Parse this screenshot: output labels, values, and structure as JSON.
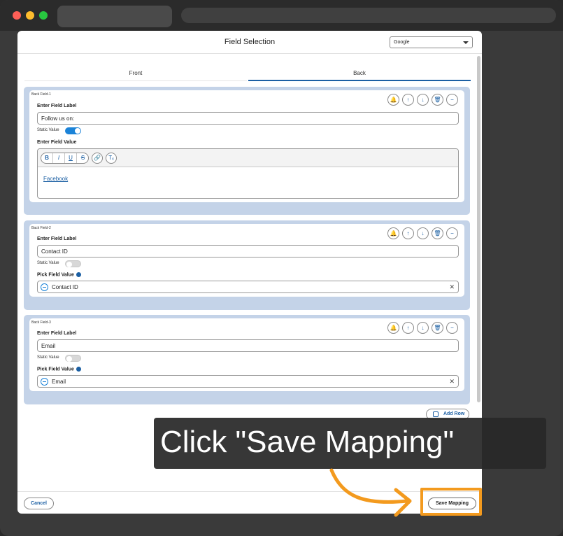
{
  "modal": {
    "title": "Field Selection",
    "select_value": "Google",
    "tabs": [
      {
        "label": "Front"
      },
      {
        "label": "Back"
      }
    ],
    "active_tab": "Back"
  },
  "fields": [
    {
      "card_label": "Back Field-1",
      "label_heading": "Enter Field Label",
      "label_value": "Follow us on:",
      "static_label": "Static Value",
      "static_on": true,
      "value_heading": "Enter Field Value",
      "editor_content": "Facebook",
      "toolbar": [
        "B",
        "I",
        "U",
        "S",
        "link",
        "Tx"
      ]
    },
    {
      "card_label": "Back Field-2",
      "label_heading": "Enter Field Label",
      "label_value": "Contact ID",
      "static_label": "Static Value",
      "static_on": false,
      "value_heading": "Pick Field Value",
      "picked_value": "Contact ID"
    },
    {
      "card_label": "Back Field-3",
      "label_heading": "Enter Field Label",
      "label_value": "Email",
      "static_label": "Static Value",
      "static_on": false,
      "value_heading": "Pick Field Value",
      "picked_value": "Email"
    }
  ],
  "actions": {
    "add_row": "Add Row",
    "cancel": "Cancel",
    "save_mapping": "Save Mapping"
  },
  "callout": {
    "text": "Click \"Save Mapping\""
  },
  "colors": {
    "accent": "#1b5fa3",
    "card_bg": "#c4d3e8",
    "highlight": "#f39a1e"
  }
}
